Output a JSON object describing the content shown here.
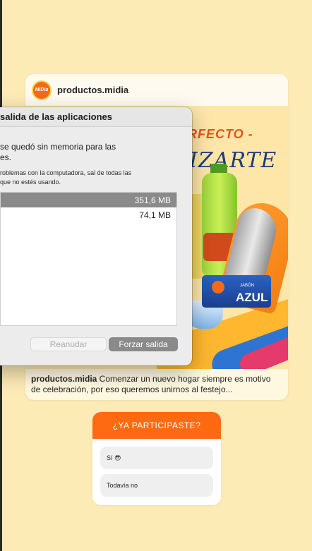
{
  "post": {
    "username": "productos.midia",
    "avatar_text": "MiDia",
    "promo_line1": "RFECTO -",
    "promo_line2": "IZARTE",
    "soap_text": "AZUL",
    "soap_small": "JABÓN",
    "caption_user": "productos.midia",
    "caption_text": " Comenzar un nuevo hogar siempre es motivo de celebración, por eso queremos unirnos al festejo..."
  },
  "dialog": {
    "title": "salida de las aplicaciones",
    "message": "se quedó sin memoria para las\nes.",
    "sub_message": "roblemas con la computadora, sal de todas las\nque no estés usando.",
    "apps": [
      {
        "memory": "351,6 MB",
        "selected": true
      },
      {
        "memory": "74,1 MB",
        "selected": false
      }
    ],
    "resume_label": "Reanudar",
    "force_label": "Forzar salida"
  },
  "poll": {
    "question": "¿YA PARTICIPASTE?",
    "options": [
      "Sí 😎",
      "Todavía no"
    ]
  },
  "colors": {
    "background": "#fdebb6",
    "brand_orange": "#fe6a12",
    "selection_gray": "#8a8a8a"
  }
}
